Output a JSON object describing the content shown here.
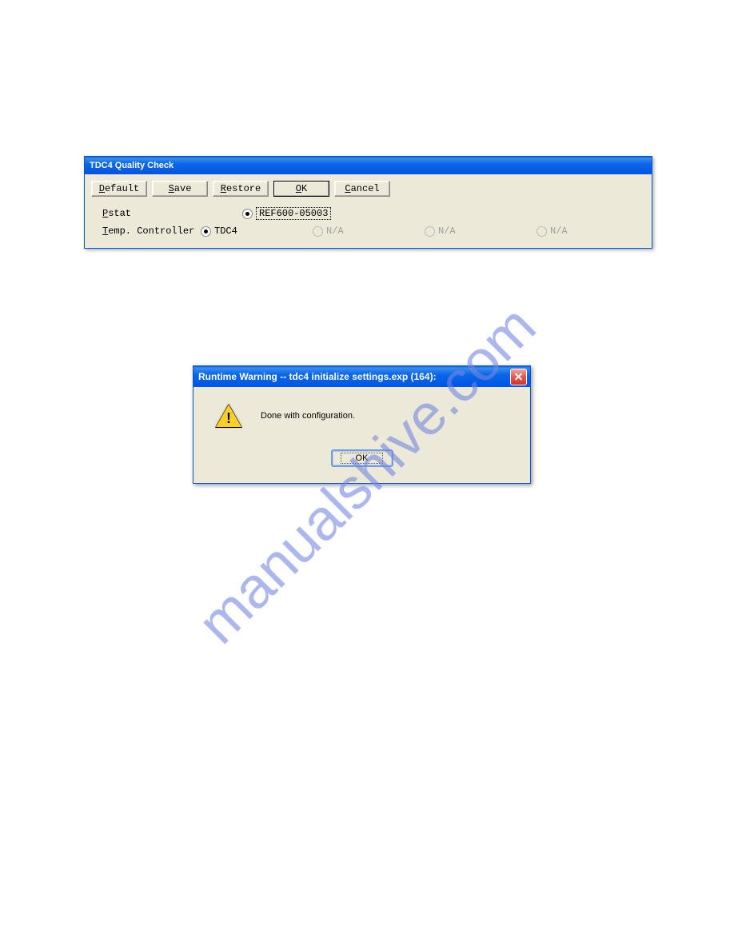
{
  "watermark": "manualshive.com",
  "dialog1": {
    "title": "TDC4 Quality Check",
    "buttons": {
      "default": "Default",
      "save": "Save",
      "restore": "Restore",
      "ok": "OK",
      "cancel": "Cancel"
    },
    "rows": [
      {
        "label": "Pstat",
        "underline_pos": 0,
        "options": [
          {
            "label": "REF600-05003",
            "selected": true,
            "disabled": false,
            "focused": true
          }
        ]
      },
      {
        "label": "Temp. Controller",
        "underline_pos": 0,
        "options": [
          {
            "label": "TDC4",
            "selected": true,
            "disabled": false
          },
          {
            "label": "N/A",
            "selected": false,
            "disabled": true
          },
          {
            "label": "N/A",
            "selected": false,
            "disabled": true
          },
          {
            "label": "N/A",
            "selected": false,
            "disabled": true
          }
        ]
      }
    ]
  },
  "dialog2": {
    "title": "Runtime Warning -- tdc4 initialize settings.exp (164):",
    "message": "Done with configuration.",
    "ok_label": "OK"
  }
}
